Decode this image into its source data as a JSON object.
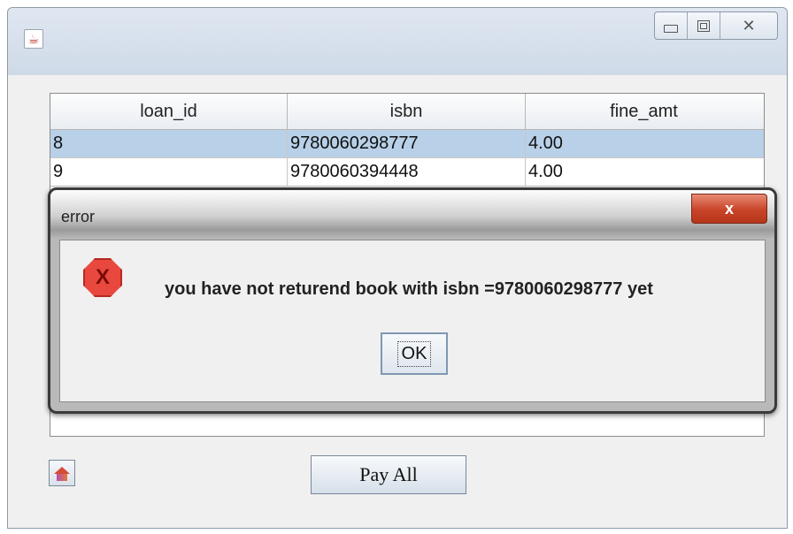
{
  "window": {
    "controls": {
      "minimize": "",
      "maximize": "",
      "close": "✕"
    }
  },
  "table": {
    "columns": [
      "loan_id",
      "isbn",
      "fine_amt"
    ],
    "rows": [
      {
        "loan_id": "8",
        "isbn": "9780060298777",
        "fine_amt": "4.00",
        "selected": true
      },
      {
        "loan_id": "9",
        "isbn": "9780060394448",
        "fine_amt": "4.00",
        "selected": false
      }
    ]
  },
  "buttons": {
    "home_icon": "home-icon",
    "pay_all": "Pay All"
  },
  "dialog": {
    "title": "error",
    "close": "x",
    "icon": "error-icon",
    "icon_glyph": "X",
    "message": "you have not returend book with isbn =9780060298777 yet",
    "ok_label": "OK"
  }
}
